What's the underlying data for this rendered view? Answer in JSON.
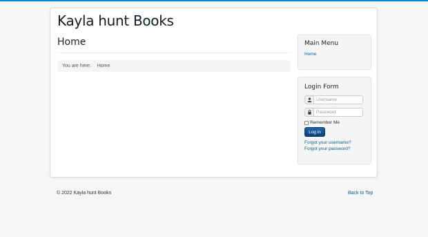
{
  "site": {
    "title": "Kayla hunt Books"
  },
  "page": {
    "title": "Home"
  },
  "breadcrumb": {
    "prefix": "You are here:",
    "current": "Home"
  },
  "main_menu": {
    "title": "Main Menu",
    "items": [
      {
        "label": "Home"
      }
    ]
  },
  "login_form": {
    "title": "Login Form",
    "username_placeholder": "Username",
    "password_placeholder": "Password",
    "username_icon": "user-icon",
    "password_icon": "lock-icon",
    "remember_label": "Remember Me",
    "login_button": "Log in",
    "forgot_username": "Forgot your username?",
    "forgot_password": "Forgot your password?"
  },
  "footer": {
    "copyright": "© 2022 Kayla hunt Books",
    "back_to_top": "Back to Top"
  },
  "colors": {
    "accent": "#0088cc",
    "link": "#0b5a94",
    "button": "#0b3f7a",
    "panel": "#f5f5f5",
    "background": "#f4f6f7"
  }
}
